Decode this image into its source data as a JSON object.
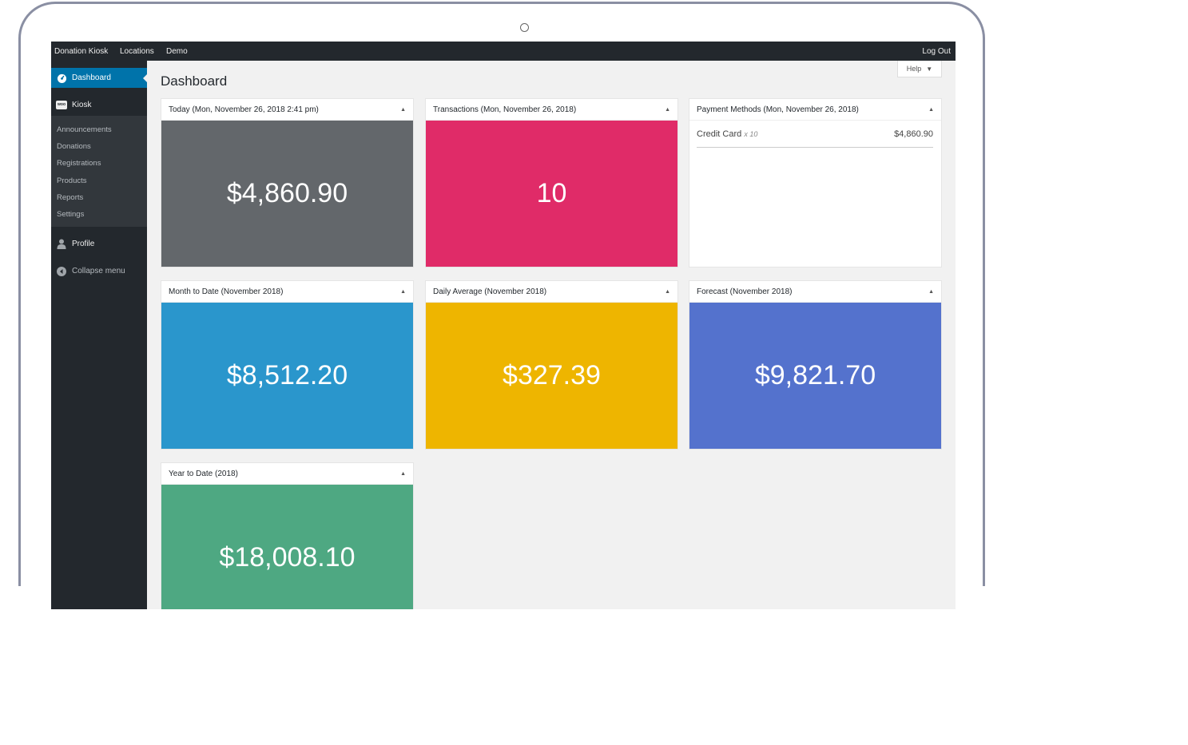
{
  "adminbar": {
    "items": [
      "Donation Kiosk",
      "Locations",
      "Demo"
    ],
    "logout": "Log Out"
  },
  "sidebar": {
    "dashboard": "Dashboard",
    "kiosk": "Kiosk",
    "kiosk_icon_text": "woo",
    "submenu": [
      "Announcements",
      "Donations",
      "Registrations",
      "Products",
      "Reports",
      "Settings"
    ],
    "profile": "Profile",
    "collapse": "Collapse menu"
  },
  "help": {
    "label": "Help"
  },
  "page": {
    "title": "Dashboard"
  },
  "widgets": {
    "today": {
      "title": "Today (Mon, November 26, 2018 2:41 pm)",
      "value": "$4,860.90",
      "color": "#63676b"
    },
    "transactions": {
      "title": "Transactions (Mon, November 26, 2018)",
      "value": "10",
      "color": "#e02b68"
    },
    "payment_methods": {
      "title": "Payment Methods (Mon, November 26, 2018)",
      "rows": [
        {
          "method": "Credit Card",
          "count": "x 10",
          "amount": "$4,860.90"
        }
      ]
    },
    "month": {
      "title": "Month to Date (November 2018)",
      "value": "$8,512.20",
      "color": "#2a96cc"
    },
    "daily": {
      "title": "Daily Average (November 2018)",
      "value": "$327.39",
      "color": "#eeb500"
    },
    "forecast": {
      "title": "Forecast (November 2018)",
      "value": "$9,821.70",
      "color": "#5472cd"
    },
    "year": {
      "title": "Year to Date (2018)",
      "value": "$18,008.10",
      "color": "#4ea882"
    }
  },
  "toggle_glyph": "▲",
  "caret_glyph": "▼"
}
